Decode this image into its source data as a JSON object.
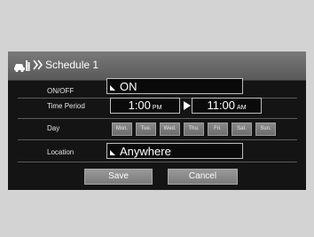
{
  "title": {
    "icon": "car-schedule-icon",
    "text": "Schedule 1"
  },
  "rows": {
    "onoff": {
      "label": "ON/OFF",
      "value": "ON"
    },
    "time_period": {
      "label": "Time Period",
      "start": {
        "time": "1:00",
        "ampm": "PM"
      },
      "end": {
        "time": "11:00",
        "ampm": "AM"
      }
    },
    "day": {
      "label": "Day",
      "days": [
        "Mon.",
        "Tue.",
        "Wed.",
        "Thu.",
        "Fri.",
        "Sat.",
        "Sun."
      ]
    },
    "location": {
      "label": "Location",
      "value": "Anywhere"
    }
  },
  "actions": {
    "save": "Save",
    "cancel": "Cancel"
  },
  "colors": {
    "bezel": "#d3d3d3",
    "screen": "#141414",
    "title_bar": "#6b6b6b",
    "button": "#8a8a8a"
  }
}
